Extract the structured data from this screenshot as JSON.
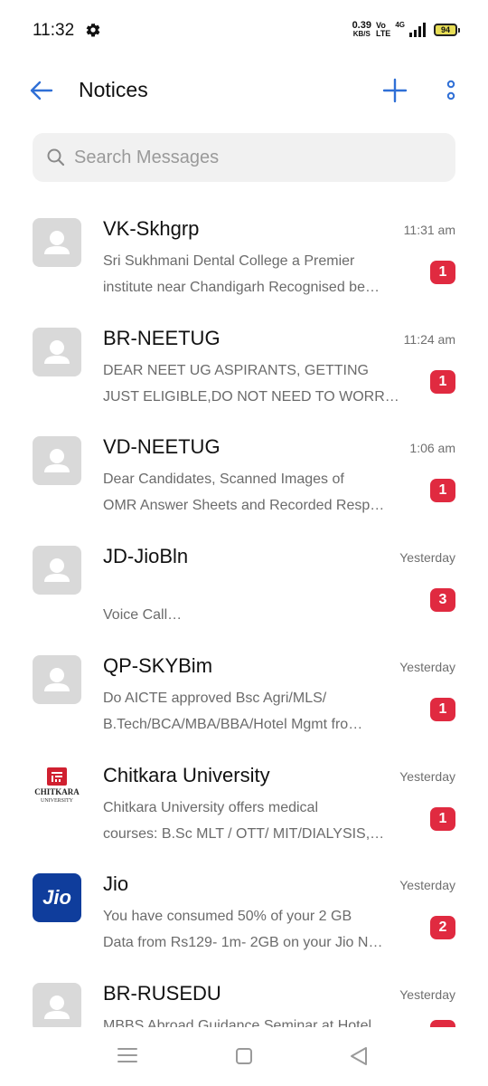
{
  "status_bar": {
    "time": "11:32",
    "net_speed_value": "0.39",
    "net_speed_unit": "KB/S",
    "volte_top": "Vo",
    "volte_bottom": "LTE",
    "signal_label": "4G",
    "battery": "94"
  },
  "header": {
    "title": "Notices",
    "icons": [
      "back-arrow-icon",
      "plus-icon",
      "more-vertical-icon"
    ],
    "accent_color": "#2f6fd6"
  },
  "search": {
    "placeholder": "Search Messages",
    "value": ""
  },
  "badge_color": "#e02a40",
  "messages": [
    {
      "sender": "VK-Skhgrp",
      "time": "11:31 am",
      "line1": "Sri Sukhmani Dental College a Premier",
      "line2": "institute near Chandigarh Recognised be…",
      "unread": "1",
      "avatar": "default"
    },
    {
      "sender": "BR-NEETUG",
      "time": "11:24 am",
      "line1": "DEAR NEET UG ASPIRANTS, GETTING",
      "line2": "JUST ELIGIBLE,DO NOT NEED TO WORR…",
      "unread": "1",
      "avatar": "default"
    },
    {
      "sender": "VD-NEETUG",
      "time": "1:06 am",
      "line1": "Dear Candidates, Scanned Images of",
      "line2": "OMR Answer Sheets and Recorded Resp…",
      "unread": "1",
      "avatar": "default"
    },
    {
      "sender": "JD-JioBln",
      "time": "Yesterday",
      "line1": "",
      "line2": "Voice Call…",
      "unread": "3",
      "avatar": "default"
    },
    {
      "sender": "QP-SKYBim",
      "time": "Yesterday",
      "line1": "Do AICTE approved Bsc Agri/MLS/",
      "line2": "B.Tech/BCA/MBA/BBA/Hotel Mgmt fro…",
      "unread": "1",
      "avatar": "default"
    },
    {
      "sender": "Chitkara University",
      "time": "Yesterday",
      "line1": "Chitkara University offers medical",
      "line2": "courses: B.Sc MLT / OTT/ MIT/DIALYSIS,…",
      "unread": "1",
      "avatar": "chitkara-logo",
      "logo_text": "CHITKARA",
      "logo_sub": "UNIVERSITY"
    },
    {
      "sender": "Jio",
      "time": "Yesterday",
      "line1": "You have consumed 50% of your 2 GB",
      "line2": "Data from Rs129- 1m- 2GB on your Jio N…",
      "unread": "2",
      "avatar": "jio-logo",
      "logo_text": "Jio"
    },
    {
      "sender": "BR-RUSEDU",
      "time": "Yesterday",
      "line1": "MBBS Abroad Guidance Seminar at Hotel",
      "line2": "",
      "unread": "",
      "avatar": "default"
    }
  ],
  "nav_bar": {
    "icons": [
      "recent-apps-icon",
      "home-icon",
      "back-icon"
    ]
  }
}
